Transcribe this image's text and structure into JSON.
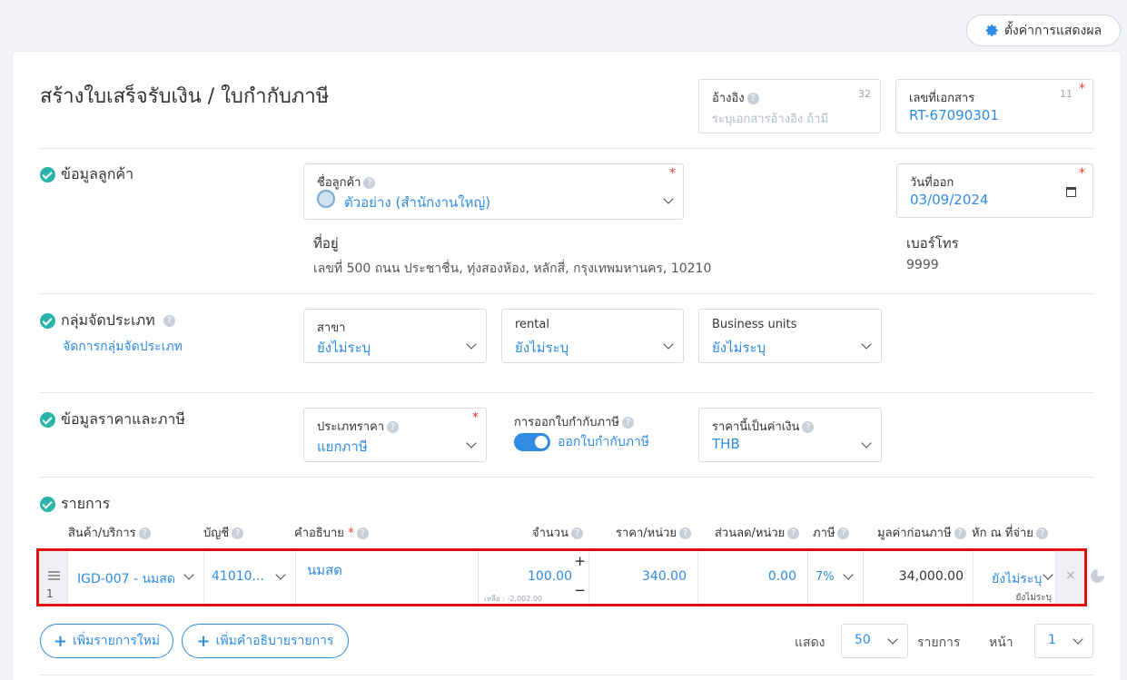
{
  "settings_label": "ตั้งค่าการแสดงผล",
  "title": "สร้างใบเสร็จรับเงิน / ใบกำกับภาษี",
  "reference": {
    "label": "อ้างอิง",
    "placeholder": "ระบุเอกสารอ้างอิง ถ้ามี",
    "counter": "32"
  },
  "doc_number": {
    "label": "เลขที่เอกสาร",
    "value": "RT-67090301",
    "counter": "11"
  },
  "customer_section": {
    "title": "ข้อมูลลูกค้า",
    "name_label": "ชื่อลูกค้า",
    "name_value": "ตัวอย่าง (สำนักงานใหญ่)",
    "address_label": "ที่อยู่",
    "address_value": "เลขที่ 500 ถนน ประชาชื่น, ทุ่งสองห้อง, หลักสี่, กรุงเทพมหานคร, 10210",
    "date_label": "วันที่ออก",
    "date_value": "03/09/2024",
    "phone_label": "เบอร์โทร",
    "phone_value": "9999"
  },
  "group_section": {
    "title": "กลุ่มจัดประเภท",
    "manage_link": "จัดการกลุ่มจัดประเภท",
    "branch_label": "สาขา",
    "branch_value": "ยังไม่ระบุ",
    "rental_label": "rental",
    "rental_value": "ยังไม่ระบุ",
    "bu_label": "Business units",
    "bu_value": "ยังไม่ระบุ"
  },
  "price_section": {
    "title": "ข้อมูลราคาและภาษี",
    "price_type_label": "ประเภทราคา",
    "price_type_value": "แยกภาษี",
    "tax_invoice_label": "การออกใบกำกับภาษี",
    "tax_invoice_value": "ออกใบกำกับภาษี",
    "currency_label": "ราคานี้เป็นค่าเงิน",
    "currency_value": "THB"
  },
  "items_section": {
    "title": "รายการ",
    "headers": {
      "product": "สินค้า/บริการ",
      "account": "บัญชี",
      "description": "คำอธิบาย",
      "qty": "จำนวน",
      "price": "ราคา/หน่วย",
      "discount": "ส่วนลด/หน่วย",
      "tax": "ภาษี",
      "pretax": "มูลค่าก่อนภาษี",
      "withholding": "หัก ณ ที่จ่าย"
    },
    "row": {
      "index": "1",
      "product": "IGD-007 - นมสด",
      "account": "41010...",
      "description": "นมสด",
      "qty": "100.00",
      "remaining": "เหลือ : -2,002.00",
      "price": "340.00",
      "discount": "0.00",
      "tax": "7%",
      "pretax": "34,000.00",
      "withholding": "ยังไม่ระบุ",
      "withholding_sub": "ยังไม่ระบุ"
    },
    "add_item": "เพิ่มรายการใหม่",
    "add_desc": "เพิ่มคำอธิบายรายการ",
    "show_label": "แสดง",
    "show_value": "50",
    "items_label": "รายการ",
    "page_label": "หน้า",
    "page_value": "1"
  },
  "colors": {
    "accent": "#2f8ce0",
    "check": "#2ab3a8",
    "highlight": "#e01010"
  }
}
